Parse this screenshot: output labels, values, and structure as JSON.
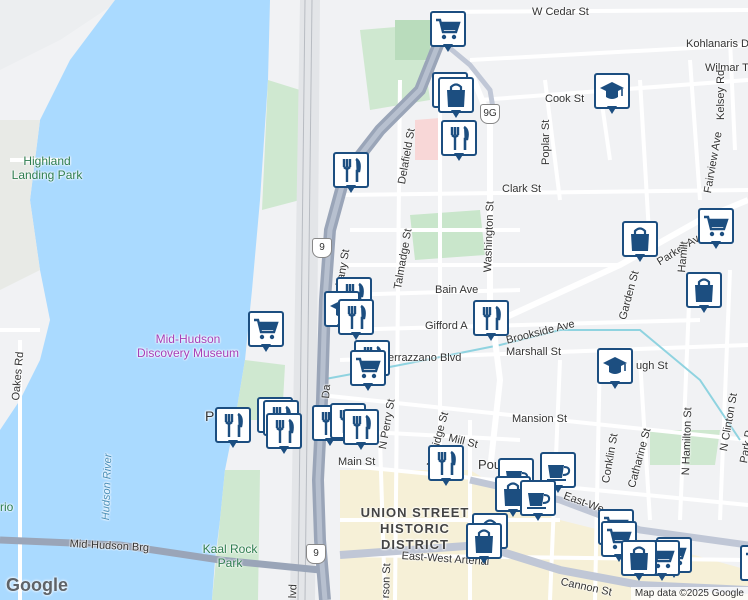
{
  "streets": {
    "w_cedar": "W Cedar St",
    "kohlanaris": "Kohlanaris D",
    "wilmar": "Wilmar T",
    "cook": "Cook St",
    "poplar": "Poplar St",
    "kelsey": "Kelsey Rd",
    "fairview": "Fairview Ave",
    "delafield": "Delafield St",
    "clark": "Clark St",
    "washington": "Washington St",
    "talmadge": "Talmadge St",
    "albany": "bany St",
    "parker": "Parker Ave",
    "bain": "Bain Ave",
    "hamilton_top": "Hamilt",
    "gifford": "Gifford A",
    "brookside": "Brookside Ave",
    "garden": "Garden St",
    "verrazzano": "errazzano Blvd",
    "marshall": "Marshall St",
    "rough": "ugh St",
    "mansion": "Mansion St",
    "n_hamilton": "N Hamilton St",
    "n_clinton": "N Clinton St",
    "park": "Park P",
    "mill": "Mill St",
    "n_perry": "N Perry St",
    "n_bridge": "N Bridge St",
    "conklin": "Conklin St",
    "catharine": "Catharine St",
    "main": "Main St",
    "pough": "Pough",
    "east_west_arterial": "East-West Arterial",
    "east_west_short": "East-We",
    "mid_hudson_brg": "Mid-Hudson Brg",
    "cannon": "Cannon St",
    "oakes": "Oakes Rd",
    "rson": "rson St",
    "lvd": "lvd",
    "da": "Da"
  },
  "places": {
    "highland_landing_park": "Highland Landing Park",
    "hudson_river": "Hudson River",
    "museum": "Mid-Hudson Discovery Museum",
    "district": "UNION STREET HISTORIC DISTRICT",
    "kaal_rock_park": "Kaal Rock Park",
    "rio": "rio",
    "p_letter": "P"
  },
  "shields": {
    "route9g": "9G",
    "route9a": "9",
    "route9b": "9"
  },
  "markers": [
    {
      "name": "grocery-marker",
      "icon": "cart"
    },
    {
      "name": "shopping-marker",
      "icon": "bag"
    },
    {
      "name": "restaurant-marker",
      "icon": "fork-knife"
    },
    {
      "name": "school-marker",
      "icon": "mortarboard"
    },
    {
      "name": "cafe-marker",
      "icon": "cup"
    }
  ],
  "colors": {
    "water": "#aadaff",
    "park": "#c8e6c9",
    "highway": "#9aa5b8",
    "marker_border": "#1c4e80",
    "museum": "#a63fb8"
  },
  "footer": {
    "logo": "Google",
    "attribution": "Map data ©2025 Google"
  }
}
